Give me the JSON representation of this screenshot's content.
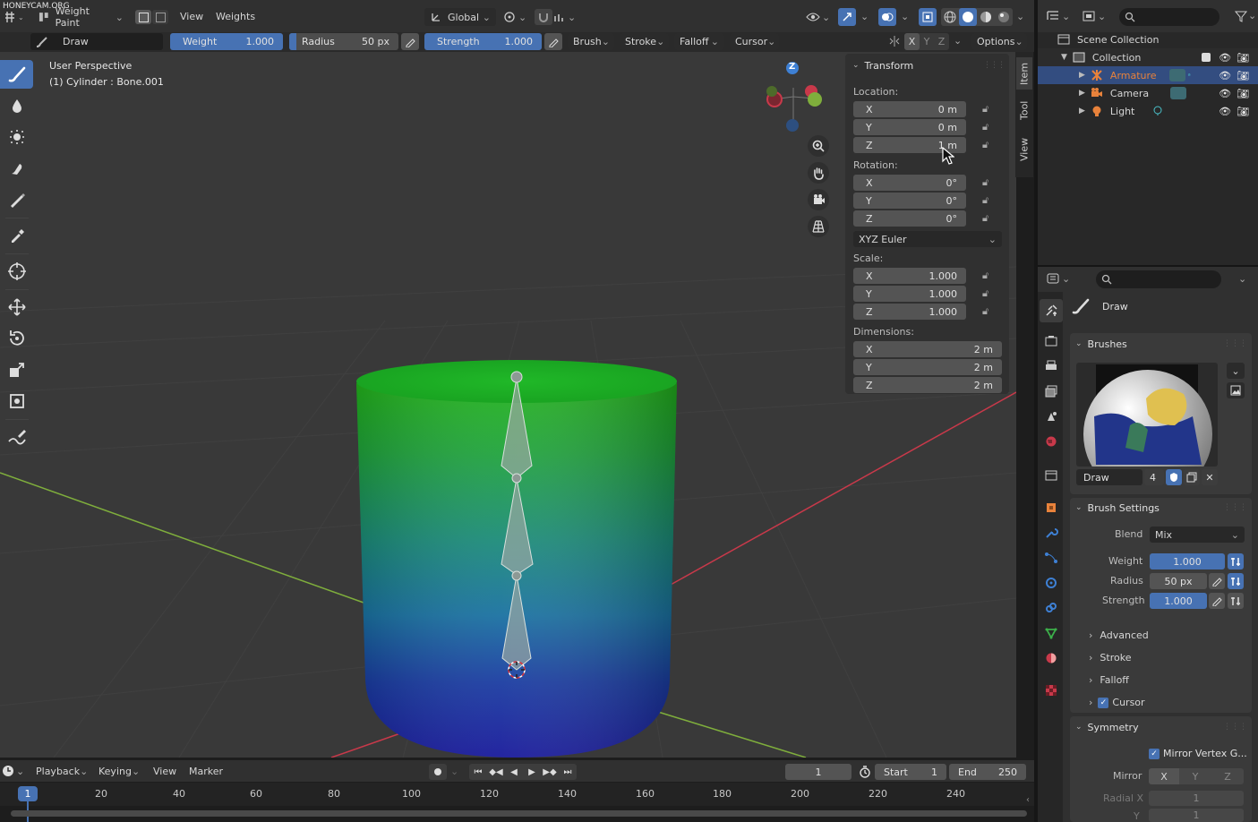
{
  "watermark": "HONEYCAM.ORG",
  "top_header": {
    "mode": "Weight Paint",
    "menus": [
      "View",
      "Weights"
    ],
    "orientation": "Global"
  },
  "tool_header": {
    "tool": "Draw",
    "weight_label": "Weight",
    "weight_value": "1.000",
    "radius_label": "Radius",
    "radius_value": "50 px",
    "strength_label": "Strength",
    "strength_value": "1.000",
    "menus": [
      "Brush",
      "Stroke",
      "Falloff",
      "Cursor"
    ],
    "axes": [
      "X",
      "Y",
      "Z"
    ],
    "options": "Options"
  },
  "viewport": {
    "title": "User Perspective",
    "subtitle": "(1) Cylinder : Bone.001",
    "gizmo_label": "Z",
    "tabs": [
      "Item",
      "Tool",
      "View"
    ]
  },
  "transform": {
    "header": "Transform",
    "location_label": "Location:",
    "location": [
      {
        "axis": "X",
        "value": "0 m"
      },
      {
        "axis": "Y",
        "value": "0 m"
      },
      {
        "axis": "Z",
        "value": "1 m"
      }
    ],
    "rotation_label": "Rotation:",
    "rotation": [
      {
        "axis": "X",
        "value": "0°"
      },
      {
        "axis": "Y",
        "value": "0°"
      },
      {
        "axis": "Z",
        "value": "0°"
      }
    ],
    "rotation_mode": "XYZ Euler",
    "scale_label": "Scale:",
    "scale": [
      {
        "axis": "X",
        "value": "1.000"
      },
      {
        "axis": "Y",
        "value": "1.000"
      },
      {
        "axis": "Z",
        "value": "1.000"
      }
    ],
    "dimensions_label": "Dimensions:",
    "dimensions": [
      {
        "axis": "X",
        "value": "2 m"
      },
      {
        "axis": "Y",
        "value": "2 m"
      },
      {
        "axis": "Z",
        "value": "2 m"
      }
    ]
  },
  "outliner": {
    "items": [
      "Scene Collection",
      "Collection",
      "Armature",
      "Camera",
      "Light"
    ]
  },
  "properties": {
    "tool_name": "Draw",
    "brushes_header": "Brushes",
    "brush_name": "Draw",
    "brush_users": "4",
    "brush_settings_header": "Brush Settings",
    "blend_label": "Blend",
    "blend_value": "Mix",
    "weight_label": "Weight",
    "weight_value": "1.000",
    "radius_label": "Radius",
    "radius_value": "50 px",
    "strength_label": "Strength",
    "strength_value": "1.000",
    "subpanels": [
      "Advanced",
      "Stroke",
      "Falloff",
      "Cursor"
    ],
    "symmetry_header": "Symmetry",
    "mirror_vertex_groups": "Mirror Vertex G...",
    "mirror_label": "Mirror",
    "radial_x_label": "Radial X",
    "radial_x_value": "1",
    "radial_y_label": "Y",
    "radial_y_value": "1"
  },
  "timeline": {
    "menus": [
      "Playback",
      "Keying",
      "View",
      "Marker"
    ],
    "current_frame": "1",
    "start_label": "Start",
    "start_value": "1",
    "end_label": "End",
    "end_value": "250",
    "ticks": [
      "1",
      "20",
      "40",
      "60",
      "80",
      "100",
      "120",
      "140",
      "160",
      "180",
      "200",
      "220",
      "240"
    ]
  },
  "colors": {
    "accent": "#4772b3",
    "armature": "#e8823b",
    "x_axis": "#c8394a",
    "y_axis": "#7fae3c",
    "z_axis": "#3e80d4"
  }
}
